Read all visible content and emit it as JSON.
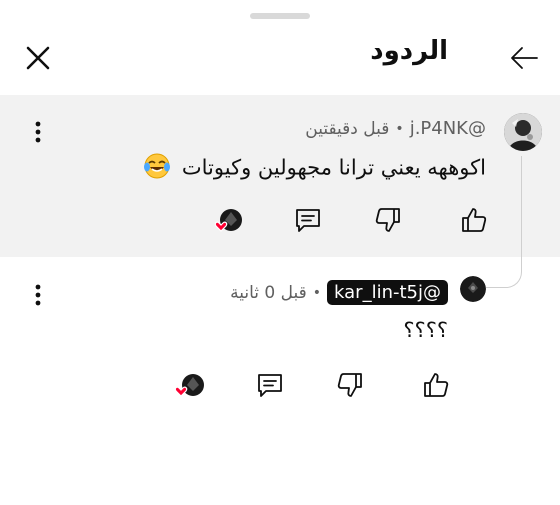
{
  "header": {
    "title": "الردود",
    "close_icon": "close-icon",
    "back_icon": "arrow-left-icon"
  },
  "parent_comment": {
    "author": "@j.P4NK",
    "time": "قبل دقيقتين",
    "separator": "•",
    "text": "اكوههه يعني ترانا مجهولين وكيوتات",
    "emoji": "face-with-tears-of-joy"
  },
  "reply": {
    "author": "@kar_lin-t5j",
    "time": "قبل 0 ثانية",
    "separator": "•",
    "text": "؟؟؟؟"
  },
  "colors": {
    "accent_heart": "#ff0033",
    "parent_bg": "#f2f2f2",
    "chip_bg": "#0f0f0f"
  }
}
